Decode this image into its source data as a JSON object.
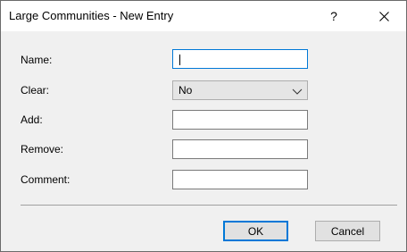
{
  "window": {
    "title": "Large Communities - New Entry",
    "help_label": "?",
    "close_icon": "close-icon"
  },
  "form": {
    "name": {
      "label": "Name:",
      "value": ""
    },
    "clear": {
      "label": "Clear:",
      "selected": "No"
    },
    "add": {
      "label": "Add:",
      "value": ""
    },
    "remove": {
      "label": "Remove:",
      "value": ""
    },
    "comment": {
      "label": "Comment:",
      "value": ""
    }
  },
  "buttons": {
    "ok_label": "OK",
    "cancel_label": "Cancel"
  },
  "colors": {
    "accent": "#0078d7",
    "dialog_bg": "#f0f0f0",
    "button_bg": "#e1e1e1"
  }
}
